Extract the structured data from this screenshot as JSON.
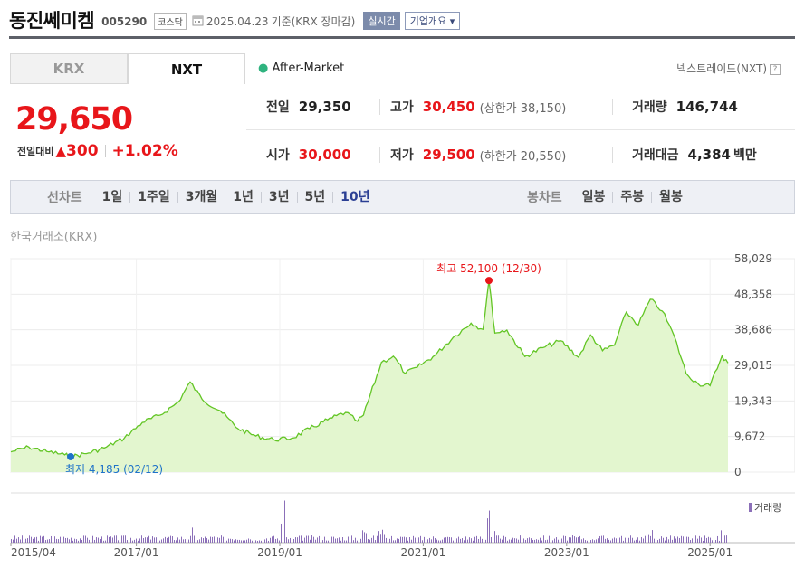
{
  "header": {
    "name": "동진쎄미켐",
    "code": "005290",
    "market": "코스닥",
    "calendar_icon": "calendar-icon",
    "date": "2025.04.23",
    "basis": "기준(KRX 장마감)",
    "live_label": "실시간",
    "overview_label": "기업개요",
    "overview_arrow": "▾"
  },
  "exchange_tabs": [
    {
      "label": "KRX",
      "active": false
    },
    {
      "label": "NXT",
      "active": true
    }
  ],
  "session": {
    "dot": "●",
    "label": "After-Market"
  },
  "nxt_label": "넥스트레이드(NXT)",
  "help_icon": "?",
  "price": {
    "current": "29,650",
    "change_label": "전일대비",
    "arrow": "▲",
    "change": "300",
    "change_pct": "+1.02%"
  },
  "stats": {
    "prev_close": {
      "label": "전일",
      "value": "29,350"
    },
    "high": {
      "label": "고가",
      "value": "30,450",
      "limit": "(상한가 38,150)"
    },
    "volume": {
      "label": "거래량",
      "value": "146,744"
    },
    "open": {
      "label": "시가",
      "value": "30,000"
    },
    "low": {
      "label": "저가",
      "value": "29,500",
      "limit": "(하한가 20,550)"
    },
    "amount": {
      "label": "거래대금",
      "value": "4,384",
      "unit": "백만"
    }
  },
  "periods": {
    "line_title": "선차트",
    "line_items": [
      "1일",
      "1주일",
      "3개월",
      "1년",
      "3년",
      "5년",
      "10년"
    ],
    "line_active": "10년",
    "candle_title": "봉차트",
    "candle_items": [
      "일봉",
      "주봉",
      "월봉"
    ]
  },
  "source_label": "한국거래소(KRX)",
  "colors": {
    "up": "#e8161a",
    "line": "#62c524",
    "fill": "#e3f6cf",
    "low_marker": "#1f73c9",
    "volume": "#8b6fb8"
  },
  "chart_data": {
    "type": "area",
    "title": "",
    "xlabel": "",
    "ylabel": "",
    "x_ticks": [
      "2015/04",
      "2017/01",
      "2019/01",
      "2021/01",
      "2023/01",
      "2025/01"
    ],
    "y_ticks": [
      "58,029",
      "48,358",
      "38,686",
      "29,015",
      "19,343",
      "9,672",
      "0"
    ],
    "ylim": [
      0,
      58029
    ],
    "x_range": [
      "2015-04",
      "2025-04"
    ],
    "series": [
      {
        "values": [
          [
            "2015-04",
            5500
          ],
          [
            "2015-07",
            6800
          ],
          [
            "2015-10",
            5600
          ],
          [
            "2016-01",
            4700
          ],
          [
            "2016-02",
            4185
          ],
          [
            "2016-05",
            5200
          ],
          [
            "2016-08",
            6800
          ],
          [
            "2016-11",
            9300
          ],
          [
            "2017-02",
            13500
          ],
          [
            "2017-05",
            15500
          ],
          [
            "2017-08",
            19000
          ],
          [
            "2017-10",
            24500
          ],
          [
            "2017-12",
            19800
          ],
          [
            "2018-03",
            16700
          ],
          [
            "2018-06",
            11800
          ],
          [
            "2018-09",
            9800
          ],
          [
            "2018-12",
            8800
          ],
          [
            "2019-03",
            9200
          ],
          [
            "2019-06",
            11800
          ],
          [
            "2019-09",
            14200
          ],
          [
            "2019-12",
            16200
          ],
          [
            "2020-02",
            13800
          ],
          [
            "2020-03",
            15500
          ],
          [
            "2020-06",
            29800
          ],
          [
            "2020-08",
            31500
          ],
          [
            "2020-10",
            26800
          ],
          [
            "2020-12",
            28500
          ],
          [
            "2021-03",
            31800
          ],
          [
            "2021-06",
            36600
          ],
          [
            "2021-09",
            40500
          ],
          [
            "2021-11",
            38800
          ],
          [
            "2021-12",
            52100
          ],
          [
            "2022-01",
            37800
          ],
          [
            "2022-03",
            38600
          ],
          [
            "2022-06",
            31400
          ],
          [
            "2022-09",
            33800
          ],
          [
            "2022-12",
            35700
          ],
          [
            "2023-03",
            31200
          ],
          [
            "2023-05",
            37300
          ],
          [
            "2023-07",
            33000
          ],
          [
            "2023-09",
            34500
          ],
          [
            "2023-11",
            43500
          ],
          [
            "2024-01",
            40000
          ],
          [
            "2024-03",
            47000
          ],
          [
            "2024-05",
            43800
          ],
          [
            "2024-07",
            37000
          ],
          [
            "2024-09",
            26800
          ],
          [
            "2024-11",
            24000
          ],
          [
            "2025-01",
            23500
          ],
          [
            "2025-03",
            31600
          ],
          [
            "2025-04",
            29650
          ]
        ]
      }
    ],
    "annotations": [
      {
        "label": "최고 52,100 (12/30)",
        "x": "2021-12",
        "y": 52100
      },
      {
        "label": "최저 4,185 (02/12)",
        "x": "2016-02",
        "y": 4185
      }
    ],
    "volume_label": "거래량",
    "volume_spikes": [
      {
        "x": "2017-10",
        "v": 0.35
      },
      {
        "x": "2019-01",
        "v": 0.55
      },
      {
        "x": "2019-02",
        "v": 1.0
      },
      {
        "x": "2019-03",
        "v": 0.6
      },
      {
        "x": "2020-03",
        "v": 0.35
      },
      {
        "x": "2020-06",
        "v": 0.3
      },
      {
        "x": "2021-12",
        "v": 0.7
      },
      {
        "x": "2022-01",
        "v": 0.45
      },
      {
        "x": "2024-03",
        "v": 0.3
      },
      {
        "x": "2025-03",
        "v": 0.35
      }
    ]
  }
}
